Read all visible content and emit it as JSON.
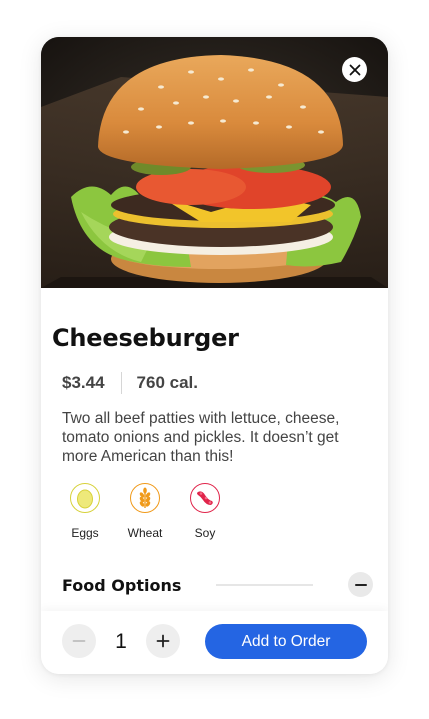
{
  "product": {
    "title": "Cheeseburger",
    "price": "$3.44",
    "calories": "760 cal.",
    "description": "Two all beef patties with lettuce, cheese, tomato onions and pickles. It doesn’t get more American than this!"
  },
  "allergens": [
    {
      "label": "Eggs",
      "icon": "egg-icon",
      "color": "#d7d13a"
    },
    {
      "label": "Wheat",
      "icon": "wheat-icon",
      "color": "#f09a1a"
    },
    {
      "label": "Soy",
      "icon": "soy-icon",
      "color": "#e0244a"
    }
  ],
  "options": {
    "title": "Food Options"
  },
  "footer": {
    "quantity": "1",
    "add_label": "Add to Order"
  },
  "colors": {
    "accent": "#2465e3"
  }
}
